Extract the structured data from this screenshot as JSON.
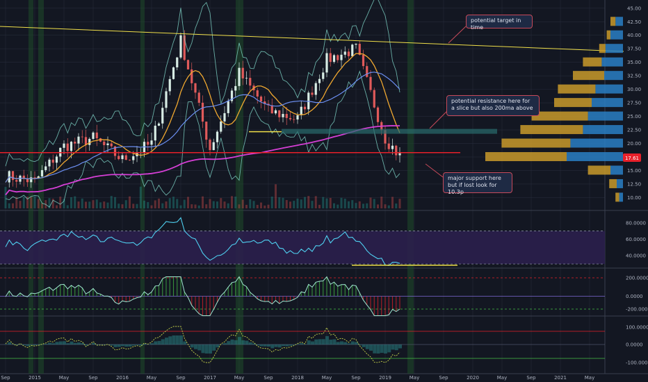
{
  "colors": {
    "background": "#131722",
    "grid": "#262b3a",
    "trendline": "#f1e04a",
    "support": "#e8202a",
    "ma_long": "#d63fd6",
    "bb_outer": "#7fd6c8",
    "ma_mid": "#f0a830",
    "ma_blue": "#6b8ef0",
    "rsi": "#4fd0f0",
    "rsi_band": "#2b1f4d",
    "volume_profile_up": "#c99a2a",
    "volume_profile_down": "#2a7fc4",
    "price_label": "#e8202a"
  },
  "x_axis_labels": [
    "Sep",
    "2015",
    "May",
    "Sep",
    "2016",
    "May",
    "Sep",
    "2017",
    "May",
    "Sep",
    "2018",
    "May",
    "Sep",
    "2019",
    "May",
    "Sep",
    "2020",
    "May",
    "Sep",
    "2021",
    "May"
  ],
  "panels": {
    "price": {
      "price_ticks": [
        "45.00",
        "42.50",
        "40.00",
        "37.50",
        "35.00",
        "32.50",
        "30.00",
        "27.50",
        "25.00",
        "22.50",
        "20.00",
        "17.50",
        "15.00",
        "12.50",
        "10.00"
      ],
      "current_price": "17.61"
    },
    "rsi": {
      "ticks": [
        "80.0000",
        "60.0000",
        "40.0000"
      ]
    },
    "macd": {
      "ticks": [
        "200.0000",
        "0.0000",
        "-200.0000"
      ]
    },
    "osc": {
      "ticks": [
        "100.0000",
        "0.0000",
        "-100.0000"
      ]
    }
  },
  "annotations": {
    "target": "potential target in time",
    "resistance": "potential resistance here for a slice but also 200ma above",
    "support": "major support here but if lost look for 10.3p"
  },
  "chart_data": {
    "type": "line",
    "x": [
      "2014-09",
      "2015-01",
      "2015-05",
      "2015-09",
      "2016-01",
      "2016-05",
      "2016-09",
      "2017-01",
      "2017-05",
      "2017-09",
      "2018-01",
      "2018-05",
      "2018-09",
      "2019-01",
      "2019-03"
    ],
    "series": [
      {
        "values": [
          14.0,
          13.0,
          19.5,
          21.0,
          17.0,
          20.0,
          39.0,
          19.0,
          33.0,
          26.0,
          24.5,
          35.5,
          37.5,
          21.0,
          17.61
        ]
      }
    ],
    "ylim": [
      8,
      46
    ],
    "horizontal_levels": {
      "major_support": 18.3,
      "resistance_zone": 22.3
    },
    "volume_profile": [
      {
        "price": 42.5,
        "up": 0.04,
        "down": 0.06
      },
      {
        "price": 40.0,
        "up": 0.03,
        "down": 0.1
      },
      {
        "price": 37.5,
        "up": 0.05,
        "down": 0.14
      },
      {
        "price": 35.0,
        "up": 0.15,
        "down": 0.17
      },
      {
        "price": 32.5,
        "up": 0.25,
        "down": 0.15
      },
      {
        "price": 30.0,
        "up": 0.3,
        "down": 0.22
      },
      {
        "price": 27.5,
        "up": 0.3,
        "down": 0.25
      },
      {
        "price": 25.0,
        "up": 0.45,
        "down": 0.28
      },
      {
        "price": 22.5,
        "up": 0.5,
        "down": 0.32
      },
      {
        "price": 20.0,
        "up": 0.55,
        "down": 0.42
      },
      {
        "price": 17.5,
        "up": 0.65,
        "down": 0.45
      },
      {
        "price": 15.0,
        "up": 0.18,
        "down": 0.1
      },
      {
        "price": 12.5,
        "up": 0.06,
        "down": 0.05
      },
      {
        "price": 10.0,
        "up": 0.03,
        "down": 0.03
      }
    ]
  }
}
